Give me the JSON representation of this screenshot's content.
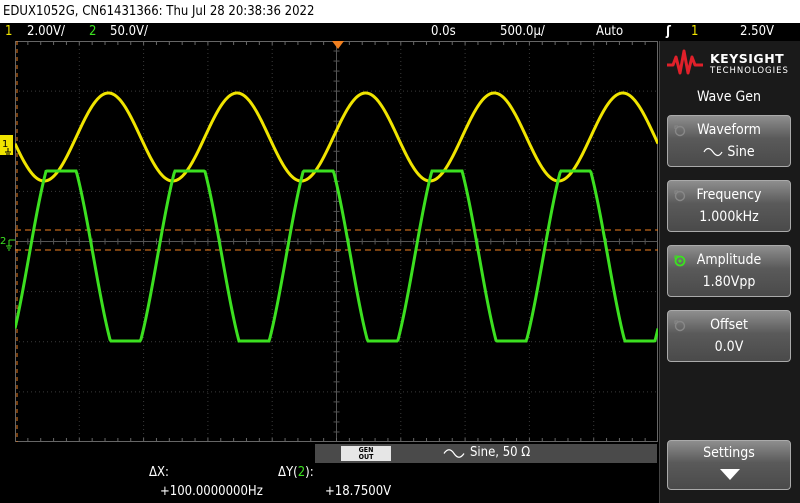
{
  "titlebar": {
    "text": "EDUX1052G, CN61431366: Thu Jul 28 20:38:36 2022"
  },
  "status": {
    "ch1_num": "1",
    "ch1_scale": "2.00V/",
    "ch2_num": "2",
    "ch2_scale": "50.0V/",
    "time_delay": "0.0s",
    "time_scale": "500.0µ/",
    "trigger_mode": "Auto",
    "trigger_source": "1",
    "trigger_level": "2.50V"
  },
  "markers": {
    "ch1": "1",
    "ch2": "2"
  },
  "brand": {
    "name": "KEYSIGHT",
    "sub": "TECHNOLOGIES"
  },
  "panel": {
    "title": "Wave Gen",
    "softkeys": [
      {
        "label": "Waveform",
        "value": "Sine"
      },
      {
        "label": "Frequency",
        "value": "1.000kHz"
      },
      {
        "label": "Amplitude",
        "value": "1.80Vpp"
      },
      {
        "label": "Offset",
        "value": "0.0V"
      }
    ],
    "settings": "Settings"
  },
  "genbar": {
    "badge_top": "GEN",
    "badge_bottom": "OUT",
    "text": "Sine, 50 Ω"
  },
  "measurements": {
    "dx_label": "ΔX:",
    "dx_value": "+100.0000000Hz",
    "dy_label": "ΔY(",
    "dy_channel": "2",
    "dy_close": "):",
    "dy_value": "+18.7500V"
  },
  "colors": {
    "ch1": "#f0e400",
    "ch2": "#3ce020",
    "cursor": "#f08020",
    "grid": "#3a3a3a"
  }
}
